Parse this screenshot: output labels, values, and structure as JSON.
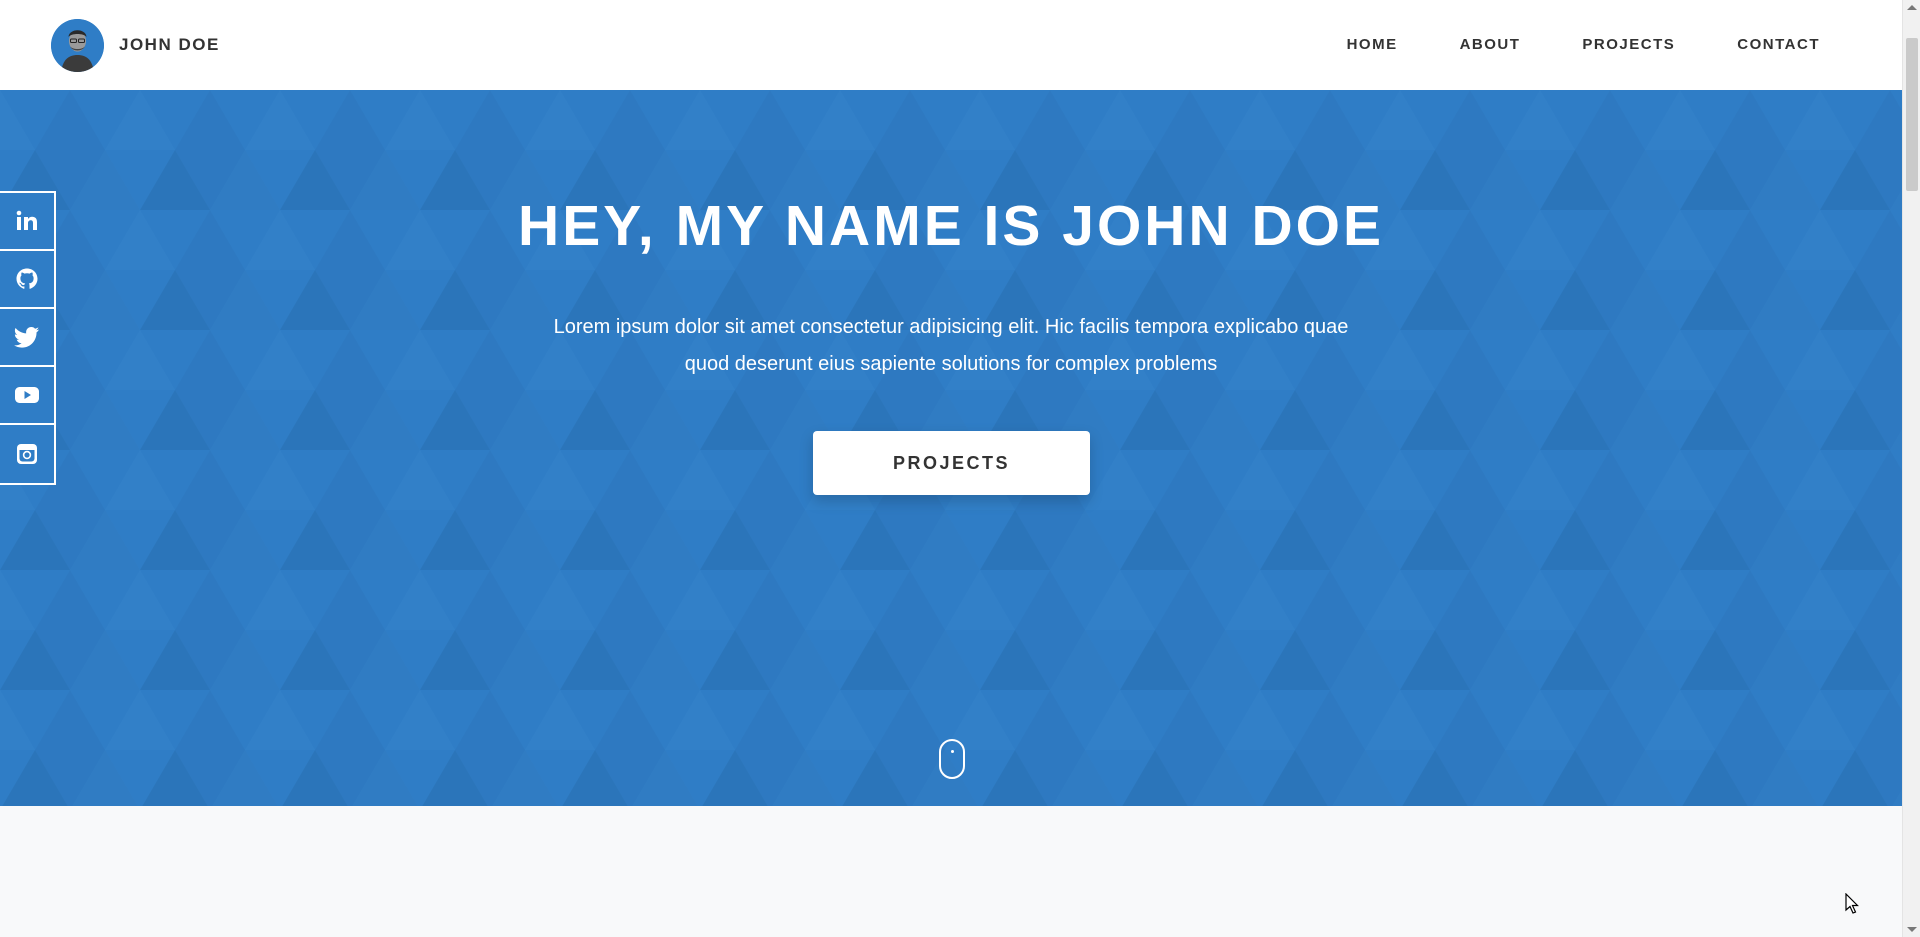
{
  "brand": {
    "name": "JOHN DOE"
  },
  "nav": {
    "items": [
      {
        "label": "HOME"
      },
      {
        "label": "ABOUT"
      },
      {
        "label": "PROJECTS"
      },
      {
        "label": "CONTACT"
      }
    ]
  },
  "hero": {
    "title": "HEY, MY NAME IS JOHN DOE",
    "text": "Lorem ipsum dolor sit amet consectetur adipisicing elit. Hic facilis tempora explicabo quae quod deserunt eius sapiente solutions for complex problems",
    "button_label": "PROJECTS"
  },
  "social": {
    "items": [
      {
        "icon": "linkedin-icon"
      },
      {
        "icon": "github-icon"
      },
      {
        "icon": "twitter-icon"
      },
      {
        "icon": "youtube-icon"
      },
      {
        "icon": "instagram-icon"
      }
    ]
  },
  "colors": {
    "primary": "#2f7dc6",
    "header_bg": "#ffffff",
    "text_dark": "#333333",
    "section_bg": "#f8f9fa"
  }
}
